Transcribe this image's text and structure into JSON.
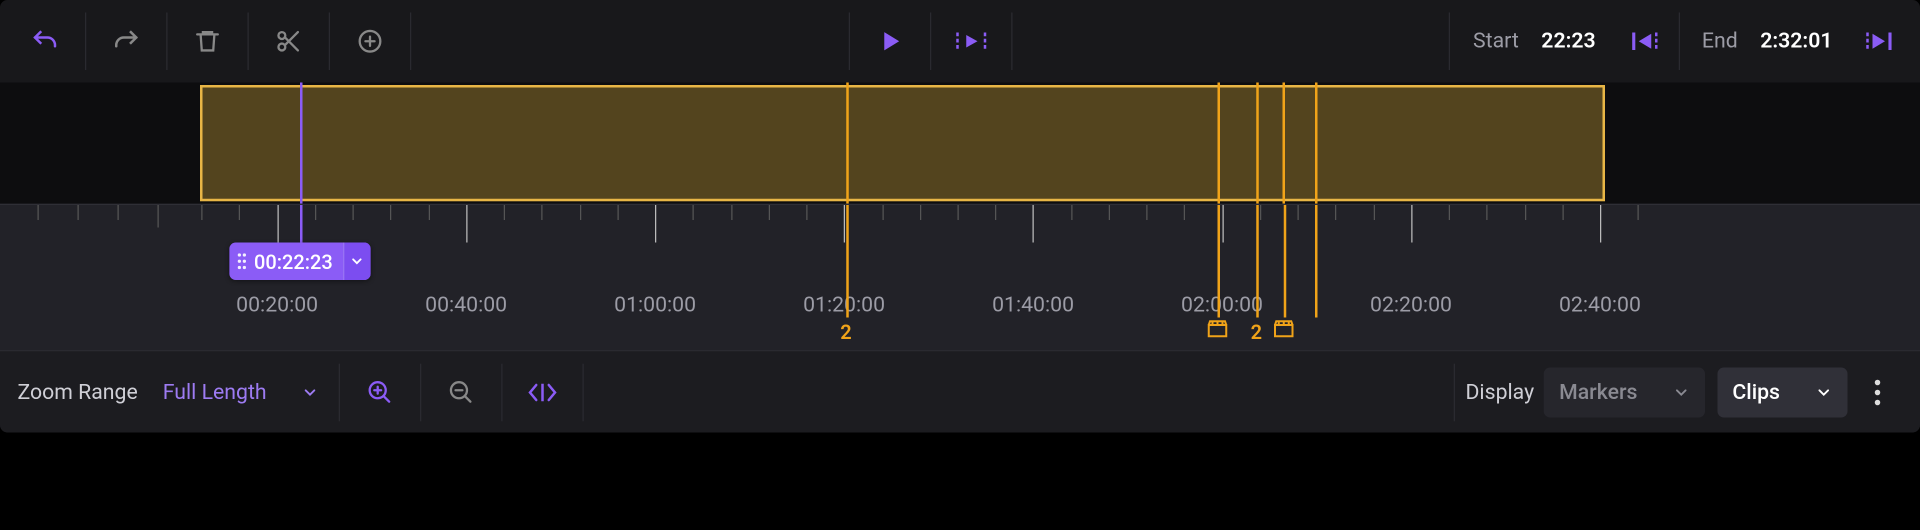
{
  "toolbar": {
    "undo": "undo",
    "redo": "redo",
    "delete": "delete",
    "cut": "cut",
    "add": "add-marker",
    "play": "play",
    "play_range": "play-range",
    "start_label": "Start",
    "start_value": "22:23",
    "go_start": "go-to-in",
    "end_label": "End",
    "end_value": "2:32:01",
    "go_end": "go-to-out"
  },
  "clip": {
    "in_pct": 0,
    "out_pct": 95.97,
    "markers_pct": [
      44.13,
      69.49,
      72.16,
      73.99,
      76.21
    ]
  },
  "ruler": {
    "range_start_sec": 710,
    "range_end_sec": 10005,
    "major_interval_sec": 1200,
    "labels": [
      "00:20:00",
      "00:40:00",
      "01:00:00",
      "01:20:00",
      "01:40:00",
      "02:00:00",
      "02:20:00",
      "02:40:00"
    ],
    "playhead_sec": 1343,
    "playhead_label": "00:22:23",
    "markers": [
      {
        "sec": 4812,
        "label": "2",
        "kind": "count"
      },
      {
        "sec": 7170,
        "kind": "clap"
      },
      {
        "sec": 7418,
        "label": "2",
        "kind": "count"
      },
      {
        "sec": 7588,
        "kind": "clap"
      },
      {
        "sec": 7794,
        "kind": "line"
      }
    ]
  },
  "bottom": {
    "zoom_label": "Zoom Range",
    "zoom_value": "Full Length",
    "zoom_in": "zoom-in",
    "zoom_out": "zoom-out",
    "fit": "zoom-fit",
    "display_label": "Display",
    "markers_label": "Markers",
    "clips_label": "Clips",
    "more": "more"
  }
}
